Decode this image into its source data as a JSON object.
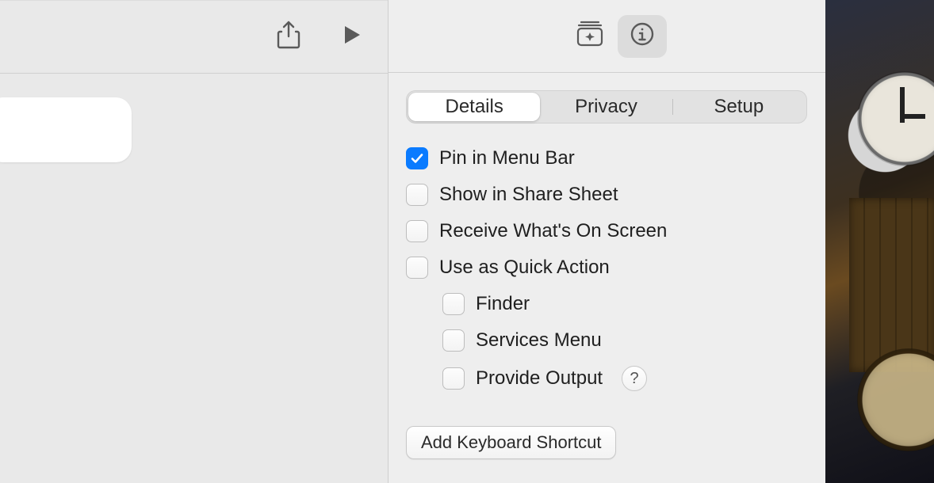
{
  "left_toolbar": {
    "share_icon": "share-icon",
    "play_icon": "play-icon"
  },
  "right_toolbar": {
    "library_icon": "library-icon",
    "info_icon": "info-icon"
  },
  "tabs": {
    "details": "Details",
    "privacy": "Privacy",
    "setup": "Setup",
    "selected": "details"
  },
  "checkboxes": {
    "pin": {
      "label": "Pin in Menu Bar",
      "checked": true
    },
    "share": {
      "label": "Show in Share Sheet",
      "checked": false
    },
    "receive": {
      "label": "Receive What's On Screen",
      "checked": false
    },
    "quick": {
      "label": "Use as Quick Action",
      "checked": false
    },
    "finder": {
      "label": "Finder",
      "checked": false
    },
    "services": {
      "label": "Services Menu",
      "checked": false
    },
    "provide": {
      "label": "Provide Output",
      "checked": false
    }
  },
  "help_glyph": "?",
  "add_shortcut_button": "Add Keyboard Shortcut"
}
